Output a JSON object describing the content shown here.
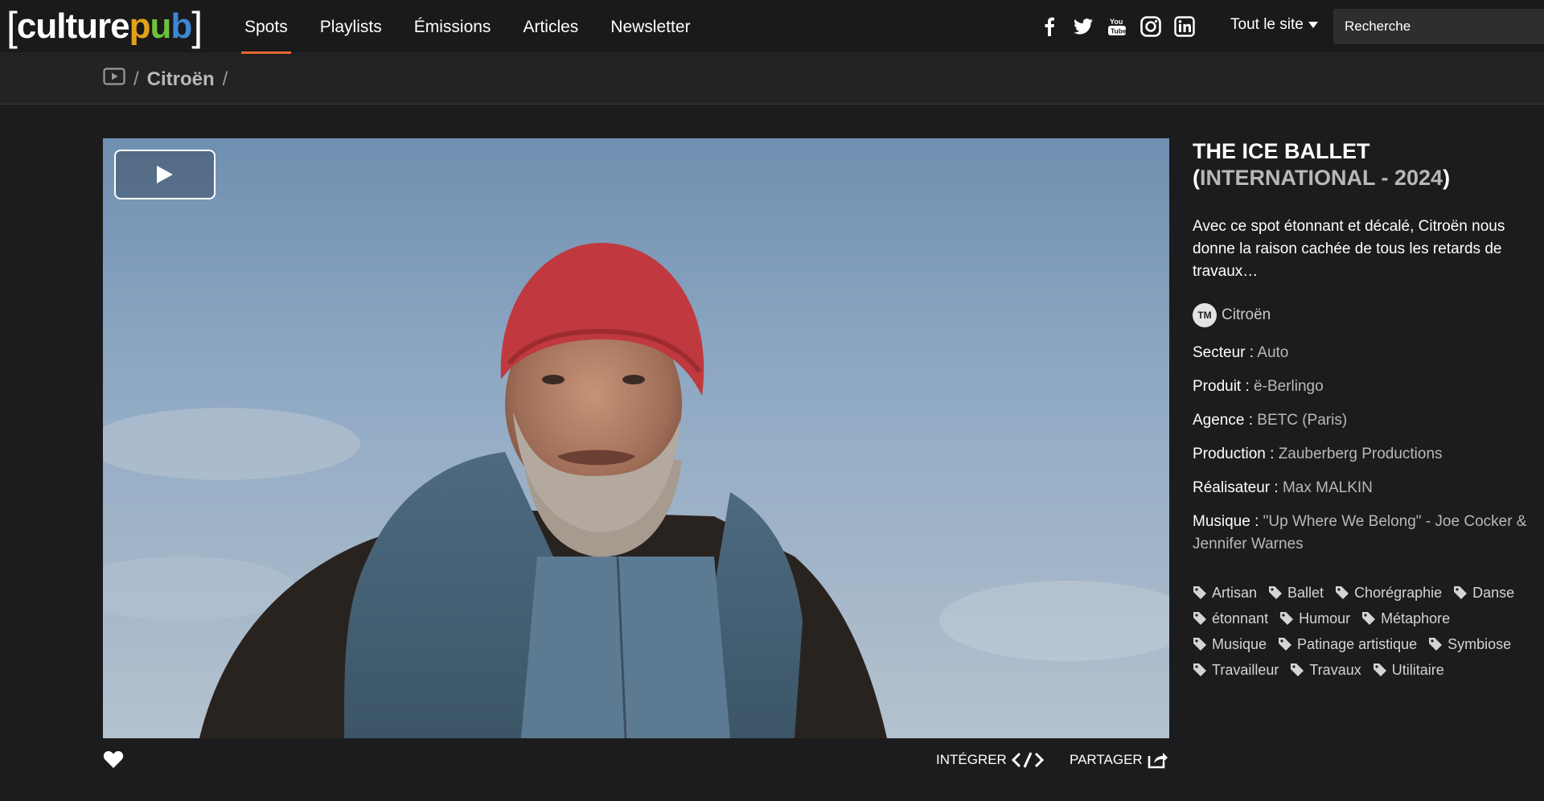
{
  "header": {
    "logo": {
      "left_bracket": "[",
      "culture": "culture",
      "p": "p",
      "u": "u",
      "b": "b",
      "right_bracket": "]"
    },
    "nav": [
      "Spots",
      "Playlists",
      "Émissions",
      "Articles",
      "Newsletter"
    ],
    "site_select": "Tout le site",
    "search_placeholder": "Recherche"
  },
  "breadcrumb": {
    "separator": "/",
    "brand": "Citroën"
  },
  "video": {},
  "actions": {
    "embed": "INTÉGRER",
    "share": "PARTAGER"
  },
  "spot": {
    "title_main": "THE ICE BALLET",
    "title_open": "(",
    "title_country": "INTERNATIONAL - 2024",
    "title_close": ")",
    "description": "Avec ce spot étonnant et décalé, Citroën nous donne la raison cachée de tous les retards de travaux…",
    "tm_badge": "TM",
    "brand": "Citroën",
    "meta": [
      {
        "key": "Secteur :",
        "value": "Auto"
      },
      {
        "key": "Produit :",
        "value": "ë-Berlingo"
      },
      {
        "key": "Agence :",
        "value": "BETC (Paris)"
      },
      {
        "key": "Production :",
        "value": "Zauberberg Productions"
      },
      {
        "key": "Réalisateur :",
        "value": "Max MALKIN"
      },
      {
        "key": "Musique :",
        "value": "\"Up Where We Belong\" - Joe Cocker & Jennifer Warnes"
      }
    ],
    "tags": [
      "Artisan",
      "Ballet",
      "Chorégraphie",
      "Danse",
      "étonnant",
      "Humour",
      "Métaphore",
      "Musique",
      "Patinage artistique",
      "Symbiose",
      "Travailleur",
      "Travaux",
      "Utilitaire"
    ]
  },
  "colors": {
    "accent": "#e8672f",
    "logo_p": "#e2a21a",
    "logo_u": "#6fc13b",
    "logo_b": "#3b88d6"
  }
}
